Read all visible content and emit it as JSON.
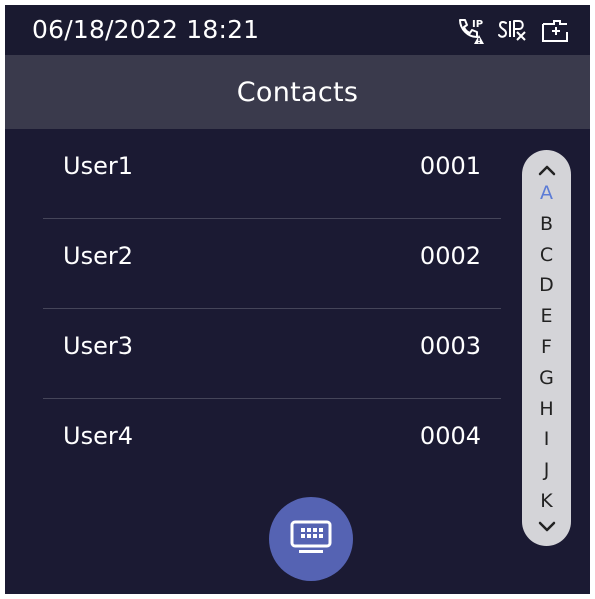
{
  "status_bar": {
    "datetime": "06/18/2022 18:21",
    "icons": [
      "ip-call-warning-icon",
      "sip-icon",
      "sd-card-icon"
    ]
  },
  "header": {
    "title": "Contacts"
  },
  "contacts": [
    {
      "name": "User1",
      "number": "0001"
    },
    {
      "name": "User2",
      "number": "0002"
    },
    {
      "name": "User3",
      "number": "0003"
    },
    {
      "name": "User4",
      "number": "0004"
    }
  ],
  "alpha_index": {
    "letters": [
      "A",
      "B",
      "C",
      "D",
      "E",
      "F",
      "G",
      "H",
      "I",
      "J",
      "K"
    ],
    "active": "A",
    "up_icon": "chevron-up-icon",
    "down_icon": "chevron-down-icon"
  },
  "keypad": {
    "icon": "keyboard-icon"
  },
  "colors": {
    "background": "#1b1a33",
    "title_bar": "#3a3a4c",
    "accent": "#5563b3",
    "active_letter": "#5c7cd6",
    "index_bg": "#d4d4d8"
  }
}
